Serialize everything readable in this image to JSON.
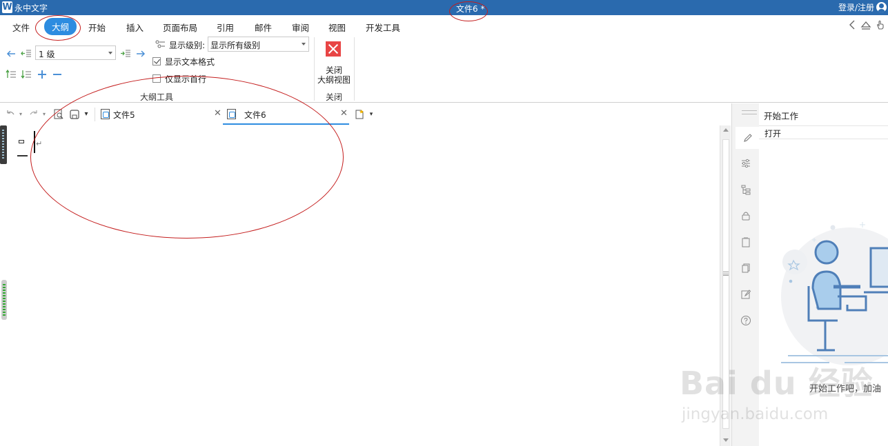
{
  "app": {
    "logo": "W",
    "name": "永中文字",
    "doc_title": "文件6 *",
    "login": "登录/注册"
  },
  "menu": {
    "items": [
      {
        "label": "文件",
        "active": false
      },
      {
        "label": "大纲",
        "active": true
      },
      {
        "label": "开始",
        "active": false
      },
      {
        "label": "插入",
        "active": false
      },
      {
        "label": "页面布局",
        "active": false
      },
      {
        "label": "引用",
        "active": false
      },
      {
        "label": "邮件",
        "active": false
      },
      {
        "label": "审阅",
        "active": false
      },
      {
        "label": "视图",
        "active": false
      },
      {
        "label": "开发工具",
        "active": false
      }
    ]
  },
  "ribbon": {
    "level_value": "1 级",
    "show_level_label": "显示级别:",
    "show_level_value": "显示所有级别",
    "show_text_format": {
      "label": "显示文本格式",
      "checked": true
    },
    "show_first_line": {
      "label": "仅显示首行",
      "checked": false
    },
    "outline_group_label": "大纲工具",
    "close_button_label_1": "关闭",
    "close_button_label_2": "大纲视图",
    "close_group_label": "关闭"
  },
  "tabs": [
    {
      "label": "文件5",
      "active": false
    },
    {
      "label": "文件6",
      "active": true
    }
  ],
  "panel": {
    "title": "开始工作",
    "open_label": "打开",
    "hint": "开始工作吧，加油"
  },
  "watermark": {
    "main": "Bai du 经验",
    "sub": "jingyan.baidu.com"
  },
  "colors": {
    "title_bar": "#2a6aae",
    "accent": "#2d8ce0",
    "close_red": "#e84545",
    "annotation": "#c41d1d"
  }
}
